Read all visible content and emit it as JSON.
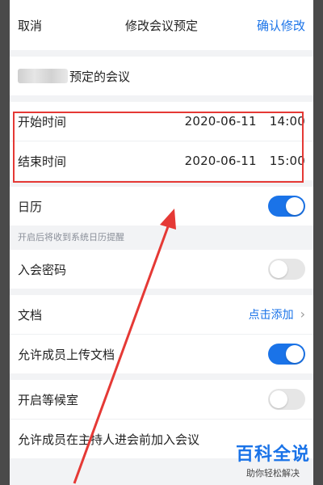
{
  "nav": {
    "cancel_label": "取消",
    "title": "修改会议预定",
    "confirm_label": "确认修改"
  },
  "topic": {
    "suffix": "预定的会议"
  },
  "time": {
    "start_label": "开始时间",
    "start_date": "2020-06-11",
    "start_time": "14:00",
    "end_label": "结束时间",
    "end_date": "2020-06-11",
    "end_time": "15:00"
  },
  "calendar": {
    "label": "日历",
    "enabled": true,
    "helper": "开启后将收到系统日历提醒"
  },
  "password": {
    "label": "入会密码",
    "enabled": false
  },
  "documents": {
    "label": "文档",
    "link_label": "点击添加"
  },
  "upload": {
    "label": "允许成员上传文档",
    "enabled": true
  },
  "waiting_room": {
    "label": "开启等候室",
    "enabled": false
  },
  "join_before_host": {
    "label": "允许成员在主持人进会前加入会议"
  },
  "watermark": {
    "main": "百科全说",
    "sub": "助你轻松解决"
  },
  "colors": {
    "accent": "#1a73e8",
    "highlight": "#e53935"
  }
}
